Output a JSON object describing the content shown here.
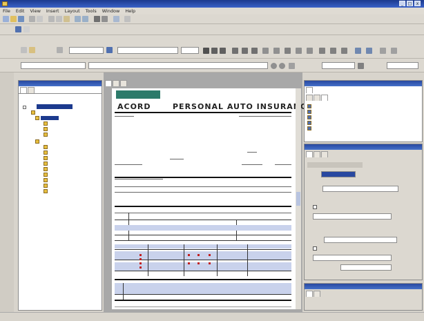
{
  "window": {
    "title": "",
    "min": "_",
    "max": "□",
    "close": "x"
  },
  "menu": [
    "File",
    "Edit",
    "View",
    "Insert",
    "Layout",
    "Tools",
    "Window",
    "Help"
  ],
  "font": {
    "name": "",
    "size": ""
  },
  "zoom_label": "",
  "zoom_value": "",
  "page_label": "",
  "page_value": "",
  "left_panel": {
    "tabs": [
      "",
      ""
    ],
    "tree": [
      "",
      "",
      "",
      "",
      "",
      "",
      "",
      "",
      "",
      "",
      "",
      "",
      "",
      "",
      "",
      ""
    ]
  },
  "editor": {
    "tabs": [
      "",
      "",
      ""
    ],
    "form_title_left": "ACORD",
    "form_title_right": "PERSONAL AUTO INSURANCE"
  },
  "right_top": {
    "tabs": [
      "",
      "",
      "",
      ""
    ],
    "items": [
      "",
      "",
      "",
      "",
      ""
    ]
  },
  "properties": {
    "tabs": [
      "",
      "",
      ""
    ],
    "fields": [
      {
        "label": "",
        "value": ""
      },
      {
        "label": "",
        "value": ""
      },
      {
        "label": "",
        "value": ""
      },
      {
        "label": "",
        "value": ""
      },
      {
        "label": "",
        "value": ""
      },
      {
        "label": "",
        "value": ""
      }
    ]
  },
  "bottom_right": {
    "tabs": [
      "",
      ""
    ]
  }
}
